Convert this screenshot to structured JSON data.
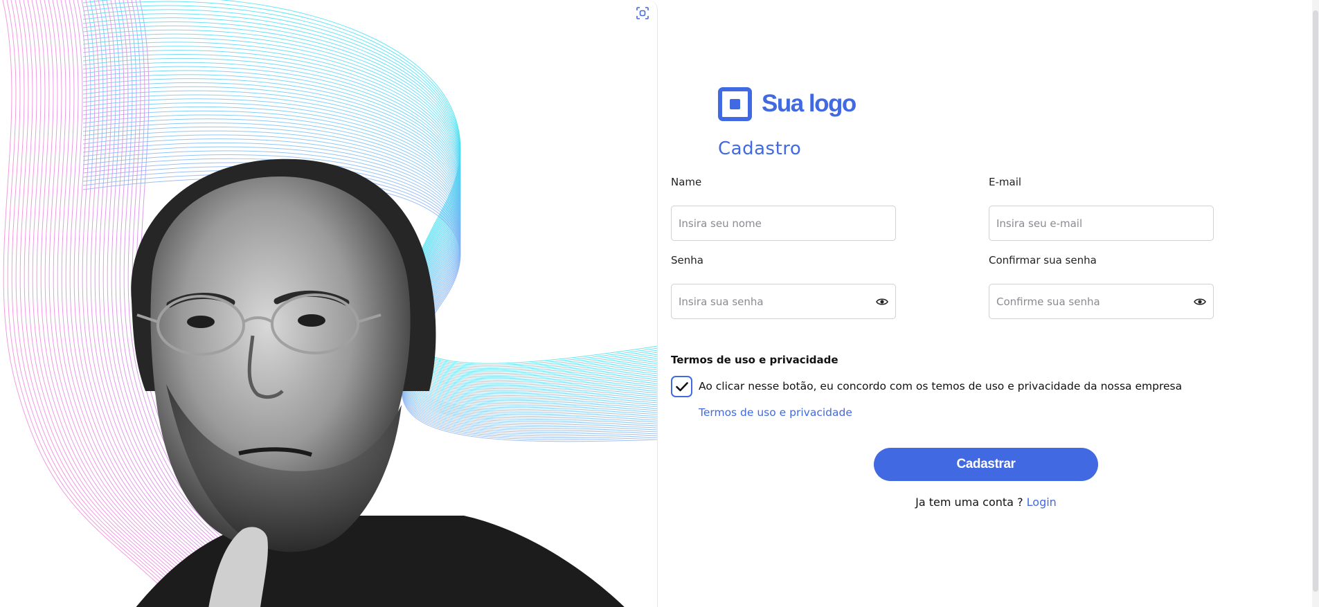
{
  "logo": {
    "text": "Sua logo"
  },
  "form": {
    "title": "Cadastro",
    "name": {
      "label": "Name",
      "placeholder": "Insira seu nome"
    },
    "email": {
      "label": "E-mail",
      "placeholder": "Insira seu e-mail"
    },
    "password": {
      "label": "Senha",
      "placeholder": "Insira sua senha"
    },
    "confirm": {
      "label": "Confirmar sua senha",
      "placeholder": "Confirme sua senha"
    },
    "terms": {
      "heading": "Termos de uso e privacidade",
      "agreement": "Ao clicar nesse botão, eu concordo com os temos de uso e privacidade da nossa empresa",
      "link": "Termos de uso e privacidade",
      "checked": true
    },
    "submit_label": "Cadastrar",
    "login_prompt": "Ja tem uma conta ?",
    "login_link": "Login"
  },
  "colors": {
    "accent": "#4169e1",
    "wave_cyan": "#3ee0f0",
    "wave_pink": "#f08ad8",
    "wave_purple": "#b48cf5"
  },
  "icons": [
    "focus-frame-icon",
    "eye-icon",
    "check-icon",
    "logo-mark-icon"
  ]
}
